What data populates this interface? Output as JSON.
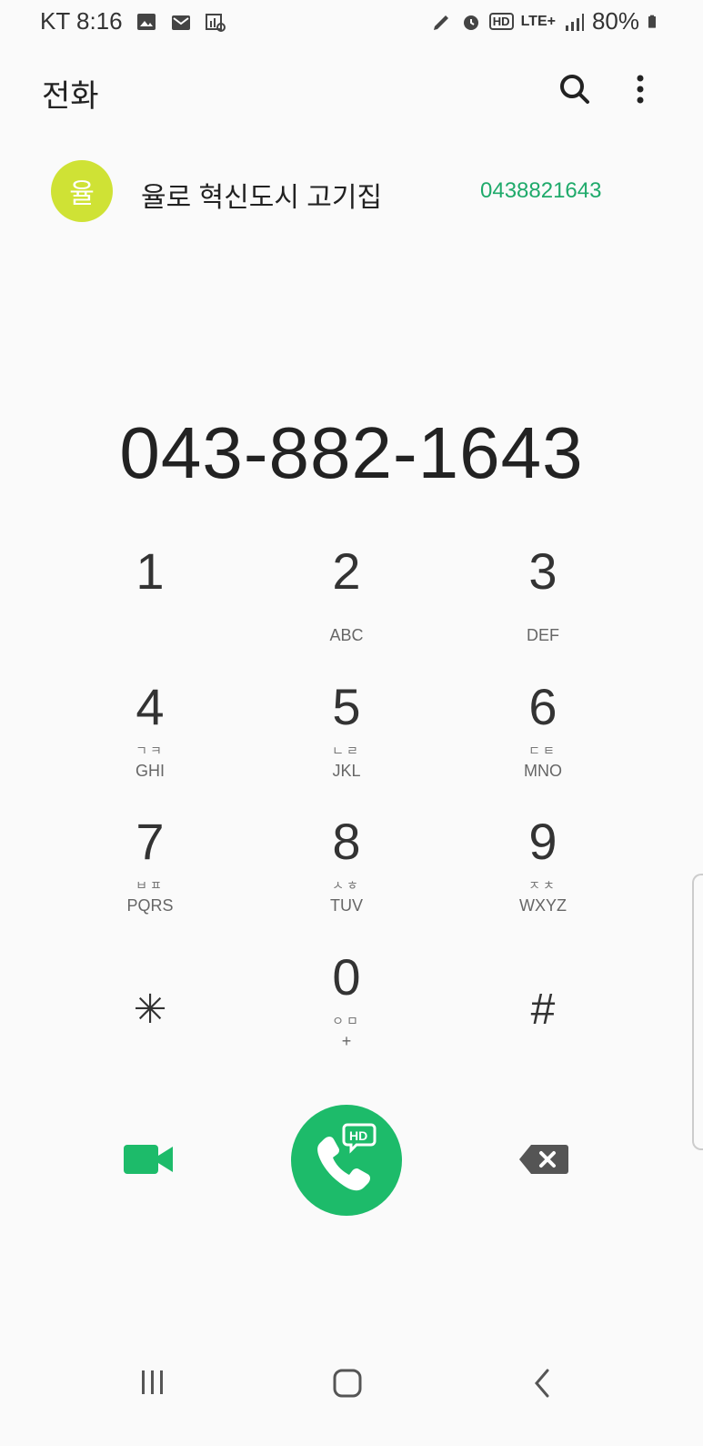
{
  "status_bar": {
    "carrier_time": "KT 8:16",
    "network": "LTE+",
    "hd_badge": "HD",
    "battery": "80%"
  },
  "header": {
    "title": "전화",
    "search_icon": "search-icon",
    "more_icon": "more-vertical-icon"
  },
  "suggestion": {
    "avatar_letter": "율",
    "avatar_color": "#cfe235",
    "name": "율로 혁신도시 고기집",
    "number": "0438821643",
    "number_color": "#1faa6b"
  },
  "dialer": {
    "number": "043-882-1643",
    "keys": [
      {
        "digit": "1",
        "korean": "",
        "letters": ""
      },
      {
        "digit": "2",
        "korean": "",
        "letters": "ABC"
      },
      {
        "digit": "3",
        "korean": "",
        "letters": "DEF"
      },
      {
        "digit": "4",
        "korean": "ㄱㅋ",
        "letters": "GHI"
      },
      {
        "digit": "5",
        "korean": "ㄴㄹ",
        "letters": "JKL"
      },
      {
        "digit": "6",
        "korean": "ㄷㅌ",
        "letters": "MNO"
      },
      {
        "digit": "7",
        "korean": "ㅂㅍ",
        "letters": "PQRS"
      },
      {
        "digit": "8",
        "korean": "ㅅㅎ",
        "letters": "TUV"
      },
      {
        "digit": "9",
        "korean": "ㅈㅊ",
        "letters": "WXYZ"
      },
      {
        "digit": "✳",
        "korean": "",
        "letters": ""
      },
      {
        "digit": "0",
        "korean": "ㅇㅁ",
        "letters": "+"
      },
      {
        "digit": "#",
        "korean": "",
        "letters": ""
      }
    ]
  },
  "actions": {
    "call_badge": "HD",
    "call_color": "#1dbb6a",
    "video_color": "#1dbb6a"
  }
}
